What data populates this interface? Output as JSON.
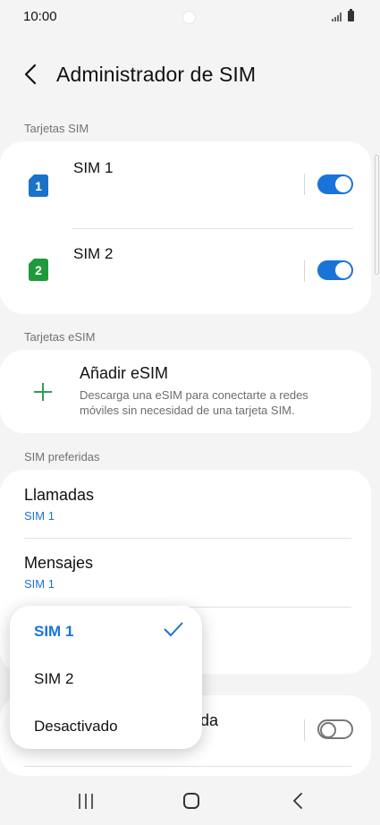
{
  "status_bar": {
    "time": "10:00"
  },
  "header": {
    "title": "Administrador de SIM"
  },
  "sections": {
    "sim_cards": "Tarjetas SIM",
    "esim": "Tarjetas eSIM",
    "preferred": "SIM preferidas"
  },
  "sims": [
    {
      "number": "1",
      "name": "SIM 1",
      "enabled": true,
      "color": "#1b72c8"
    },
    {
      "number": "2",
      "name": "SIM 2",
      "enabled": true,
      "color": "#1e9a3c"
    }
  ],
  "esim": {
    "title": "Añadir eSIM",
    "description": "Descarga una eSIM para conectarte a redes móviles sin necesidad de una tarjeta SIM."
  },
  "preferred": [
    {
      "title": "Llamadas",
      "value": "SIM 1"
    },
    {
      "title": "Mensajes",
      "value": "SIM 1"
    }
  ],
  "partial_row": {
    "text": "da"
  },
  "dropdown": {
    "options": [
      "SIM 1",
      "SIM 2",
      "Desactivado"
    ],
    "selected": "SIM 1"
  },
  "colors": {
    "accent": "#1a73d9",
    "sim1": "#1b72c8",
    "sim2": "#1e9a3c",
    "plus": "#2f9e55"
  },
  "icons": [
    "back-arrow-icon",
    "sim-card-icon",
    "plus-icon",
    "check-icon",
    "recents-icon",
    "home-icon",
    "nav-back-icon"
  ]
}
